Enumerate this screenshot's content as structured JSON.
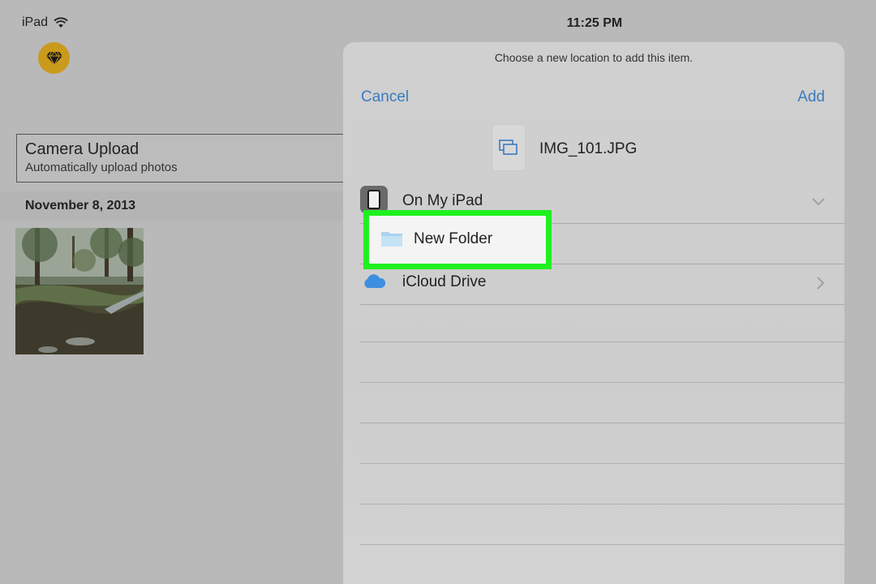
{
  "status_bar": {
    "device": "iPad",
    "time": "11:25 PM"
  },
  "app": {
    "badge_icon": "diamond-icon",
    "badge_color": "#c99a1c"
  },
  "camera_upload": {
    "title": "Camera Upload",
    "subtitle": "Automatically upload photos"
  },
  "photos": {
    "date_header": "November 8, 2013"
  },
  "modal": {
    "prompt": "Choose a new location to add this item.",
    "cancel_label": "Cancel",
    "add_label": "Add",
    "file_name": "IMG_101.JPG",
    "locations": [
      {
        "label": "On My iPad",
        "icon": "ipad-icon",
        "chevron": "chevron-down-icon"
      },
      {
        "label": "New Folder",
        "icon": "folder-icon",
        "highlighted": true
      },
      {
        "label": "iCloud Drive",
        "icon": "cloud-icon",
        "chevron": "chevron-right-icon"
      }
    ],
    "accent_color": "#3b7bbf",
    "highlight_color": "#20f020"
  }
}
